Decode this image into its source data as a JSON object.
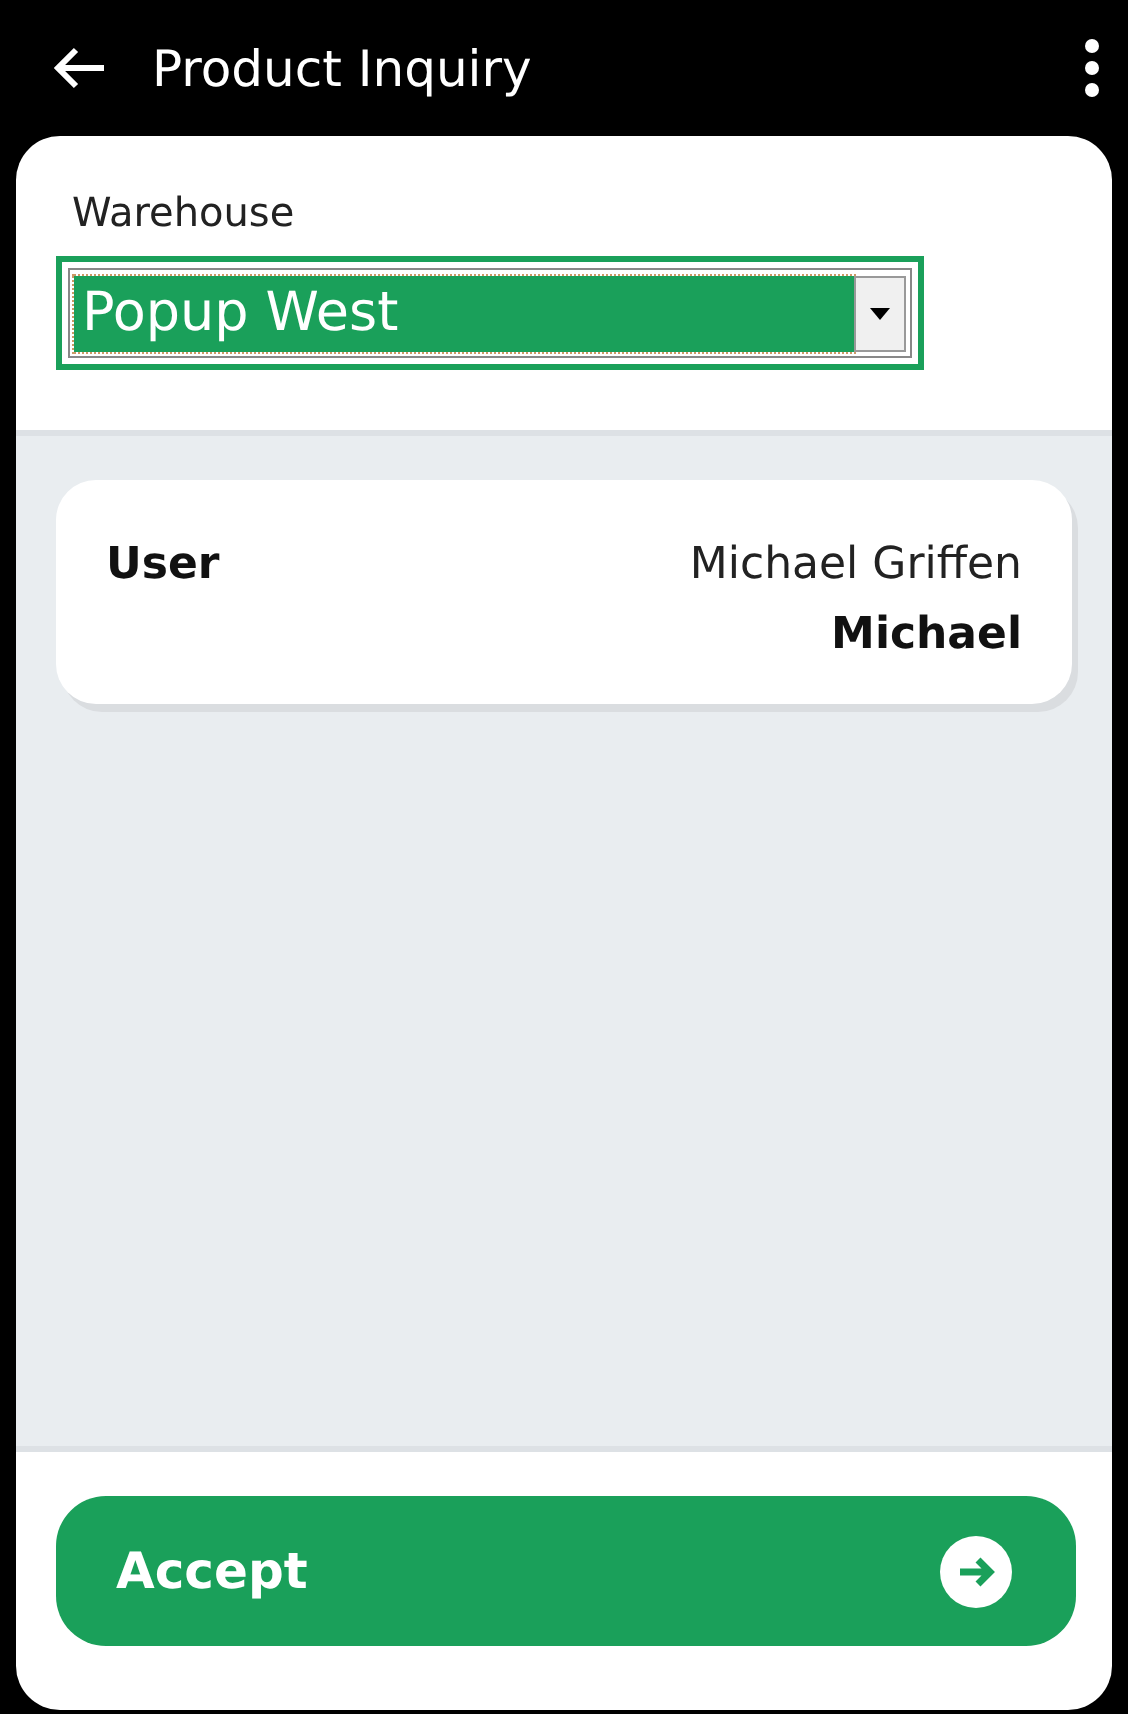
{
  "header": {
    "title": "Product Inquiry"
  },
  "warehouse": {
    "label": "Warehouse",
    "value": "Popup West",
    "focused": true
  },
  "user_card": {
    "label": "User",
    "full_name": "Michael Griffen",
    "username": "Michael"
  },
  "buttons": [
    {
      "label": "Accept",
      "kind": "primary"
    }
  ]
}
